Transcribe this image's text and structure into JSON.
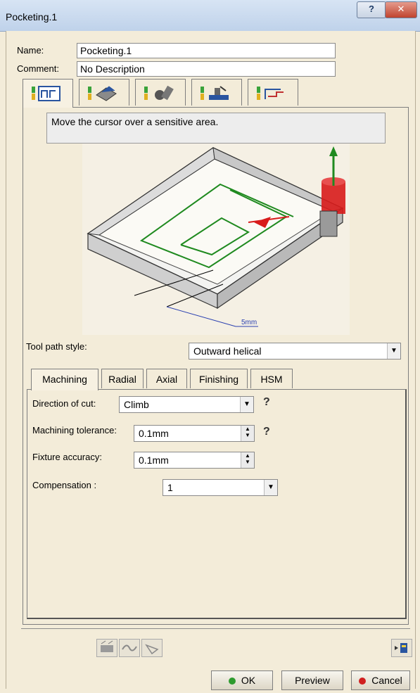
{
  "window": {
    "title": "Pocketing.1",
    "help_label": "?",
    "close_label": "✕"
  },
  "form": {
    "name_label": "Name:",
    "name_value": "Pocketing.1",
    "comment_label": "Comment:",
    "comment_value": "No Description"
  },
  "top_tabs": [
    {
      "icon": "strategy-icon",
      "active": true
    },
    {
      "icon": "geometry-icon",
      "active": false
    },
    {
      "icon": "tool-icon",
      "active": false
    },
    {
      "icon": "feeds-speeds-icon",
      "active": false
    },
    {
      "icon": "macros-icon",
      "active": false
    }
  ],
  "hint_text": "Move the cursor over a sensitive area.",
  "diagram": {
    "dimension_label": "5mm"
  },
  "tool_path_style": {
    "label": "Tool path style:",
    "value": "Outward helical"
  },
  "sub_tabs": [
    "Machining",
    "Radial",
    "Axial",
    "Finishing",
    "HSM"
  ],
  "machining": {
    "direction_label": "Direction of cut:",
    "direction_value": "Climb",
    "tolerance_label": "Machining tolerance:",
    "tolerance_value": "0.1mm",
    "fixture_label": "Fixture accuracy:",
    "fixture_value": "0.1mm",
    "compensation_label": "Compensation :",
    "compensation_value": "1",
    "help_mark": "?"
  },
  "footer": {
    "ok_label": "OK",
    "preview_label": "Preview",
    "cancel_label": "Cancel"
  },
  "colors": {
    "dialog_bg": "#f3ecd9",
    "tool_path_green": "#1f8a1f",
    "tool_red": "#d81b1b",
    "ok_led": "#2e9b2e",
    "cancel_led": "#d02020"
  }
}
